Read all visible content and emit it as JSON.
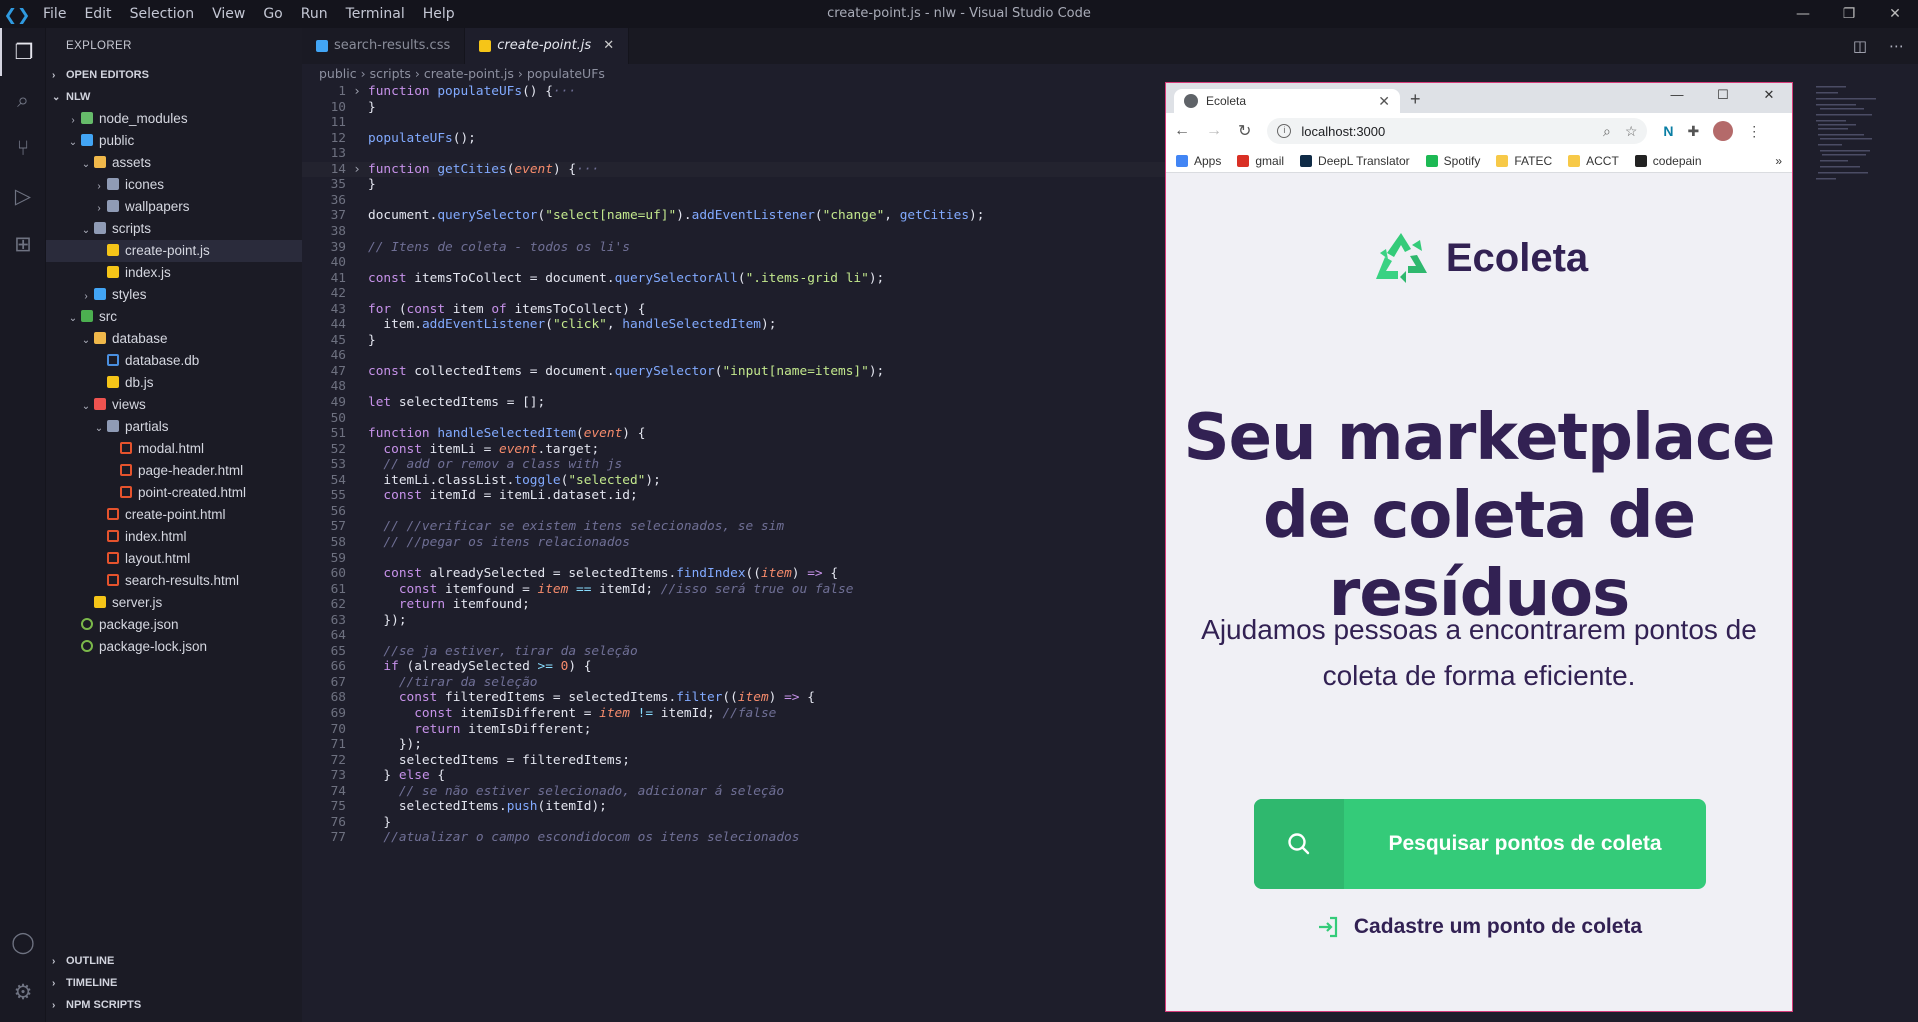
{
  "window": {
    "title": "create-point.js - nlw - Visual Studio Code"
  },
  "menu": [
    "File",
    "Edit",
    "Selection",
    "View",
    "Go",
    "Run",
    "Terminal",
    "Help"
  ],
  "window_controls": {
    "minimize": "—",
    "restore": "❐",
    "close": "✕"
  },
  "sidebar": {
    "title": "EXPLORER",
    "open_editors": "OPEN EDITORS",
    "project": "NLW",
    "tree": [
      {
        "label": "node_modules",
        "type": "folder",
        "kind": "node",
        "depth": 1,
        "arrow": "›"
      },
      {
        "label": "public",
        "type": "folder",
        "kind": "pub",
        "depth": 1,
        "arrow": "⌄"
      },
      {
        "label": "assets",
        "type": "folder",
        "kind": "assets",
        "depth": 2,
        "arrow": "⌄"
      },
      {
        "label": "icones",
        "type": "folder",
        "kind": "plain",
        "depth": 3,
        "arrow": "›"
      },
      {
        "label": "wallpapers",
        "type": "folder",
        "kind": "plain",
        "depth": 3,
        "arrow": "›"
      },
      {
        "label": "scripts",
        "type": "folder",
        "kind": "scripts",
        "depth": 2,
        "arrow": "⌄"
      },
      {
        "label": "create-point.js",
        "type": "js",
        "depth": 3,
        "selected": true
      },
      {
        "label": "index.js",
        "type": "js",
        "depth": 3
      },
      {
        "label": "styles",
        "type": "folder",
        "kind": "styles",
        "depth": 2,
        "arrow": "›"
      },
      {
        "label": "src",
        "type": "folder",
        "kind": "src",
        "depth": 1,
        "arrow": "⌄"
      },
      {
        "label": "database",
        "type": "folder",
        "kind": "db",
        "depth": 2,
        "arrow": "⌄"
      },
      {
        "label": "database.db",
        "type": "db",
        "depth": 3
      },
      {
        "label": "db.js",
        "type": "js",
        "depth": 3
      },
      {
        "label": "views",
        "type": "folder",
        "kind": "views",
        "depth": 2,
        "arrow": "⌄"
      },
      {
        "label": "partials",
        "type": "folder",
        "kind": "plain",
        "depth": 3,
        "arrow": "⌄"
      },
      {
        "label": "modal.html",
        "type": "html",
        "depth": 4
      },
      {
        "label": "page-header.html",
        "type": "html",
        "depth": 4
      },
      {
        "label": "point-created.html",
        "type": "html",
        "depth": 4
      },
      {
        "label": "create-point.html",
        "type": "html",
        "depth": 3
      },
      {
        "label": "index.html",
        "type": "html",
        "depth": 3
      },
      {
        "label": "layout.html",
        "type": "html",
        "depth": 3
      },
      {
        "label": "search-results.html",
        "type": "html",
        "depth": 3
      },
      {
        "label": "server.js",
        "type": "js",
        "depth": 2
      },
      {
        "label": "package.json",
        "type": "json",
        "depth": 1
      },
      {
        "label": "package-lock.json",
        "type": "json",
        "depth": 1
      }
    ],
    "bottom_sections": [
      "OUTLINE",
      "TIMELINE",
      "NPM SCRIPTS"
    ]
  },
  "tabs": [
    {
      "label": "search-results.css",
      "active": false,
      "icon": "css"
    },
    {
      "label": "create-point.js",
      "active": true,
      "icon": "js",
      "close": "✕"
    }
  ],
  "breadcrumb": [
    "public",
    "scripts",
    "create-point.js",
    "populateUFs"
  ],
  "code": [
    {
      "n": "1",
      "fold": "›",
      "t": [
        [
          "k",
          "function "
        ],
        [
          "f",
          "populateUFs"
        ],
        [
          "v",
          "() {"
        ],
        [
          "c",
          "···"
        ]
      ]
    },
    {
      "n": "10",
      "t": [
        [
          "v",
          "}"
        ]
      ]
    },
    {
      "n": "11",
      "t": []
    },
    {
      "n": "12",
      "t": [
        [
          "f",
          "populateUFs"
        ],
        [
          "v",
          "();"
        ]
      ]
    },
    {
      "n": "13",
      "t": []
    },
    {
      "n": "14",
      "fold": "›",
      "cur": true,
      "t": [
        [
          "k",
          "function "
        ],
        [
          "f",
          "getCities"
        ],
        [
          "v",
          "("
        ],
        [
          "p",
          "event"
        ],
        [
          "v",
          ") {"
        ],
        [
          "c",
          "···"
        ]
      ]
    },
    {
      "n": "35",
      "t": [
        [
          "v",
          "}"
        ]
      ]
    },
    {
      "n": "36",
      "t": []
    },
    {
      "n": "37",
      "t": [
        [
          "v",
          "document."
        ],
        [
          "f",
          "querySelector"
        ],
        [
          "v",
          "("
        ],
        [
          "s",
          "\"select[name=uf]\""
        ],
        [
          "v",
          ")."
        ],
        [
          "f",
          "addEventListener"
        ],
        [
          "v",
          "("
        ],
        [
          "s",
          "\"change\""
        ],
        [
          "v",
          ", "
        ],
        [
          "f",
          "getCities"
        ],
        [
          "v",
          ");"
        ]
      ]
    },
    {
      "n": "38",
      "t": []
    },
    {
      "n": "39",
      "t": [
        [
          "c",
          "// Itens de coleta - todos os li's"
        ]
      ]
    },
    {
      "n": "40",
      "t": []
    },
    {
      "n": "41",
      "t": [
        [
          "k",
          "const "
        ],
        [
          "v",
          "itemsToCollect = document."
        ],
        [
          "f",
          "querySelectorAll"
        ],
        [
          "v",
          "("
        ],
        [
          "s",
          "\".items-grid li\""
        ],
        [
          "v",
          ");"
        ]
      ]
    },
    {
      "n": "42",
      "t": []
    },
    {
      "n": "43",
      "t": [
        [
          "k",
          "for "
        ],
        [
          "v",
          "("
        ],
        [
          "k",
          "const "
        ],
        [
          "v",
          "item "
        ],
        [
          "k",
          "of "
        ],
        [
          "v",
          "itemsToCollect) {"
        ]
      ]
    },
    {
      "n": "44",
      "t": [
        [
          "v",
          "  item."
        ],
        [
          "f",
          "addEventListener"
        ],
        [
          "v",
          "("
        ],
        [
          "s",
          "\"click\""
        ],
        [
          "v",
          ", "
        ],
        [
          "f",
          "handleSelectedItem"
        ],
        [
          "v",
          ");"
        ]
      ]
    },
    {
      "n": "45",
      "t": [
        [
          "v",
          "}"
        ]
      ]
    },
    {
      "n": "46",
      "t": []
    },
    {
      "n": "47",
      "t": [
        [
          "k",
          "const "
        ],
        [
          "v",
          "collectedItems = document."
        ],
        [
          "f",
          "querySelector"
        ],
        [
          "v",
          "("
        ],
        [
          "s",
          "\"input[name=items]\""
        ],
        [
          "v",
          ");"
        ]
      ]
    },
    {
      "n": "48",
      "t": []
    },
    {
      "n": "49",
      "t": [
        [
          "k",
          "let "
        ],
        [
          "v",
          "selectedItems = [];"
        ]
      ]
    },
    {
      "n": "50",
      "t": []
    },
    {
      "n": "51",
      "t": [
        [
          "k",
          "function "
        ],
        [
          "f",
          "handleSelectedItem"
        ],
        [
          "v",
          "("
        ],
        [
          "p",
          "event"
        ],
        [
          "v",
          ") {"
        ]
      ]
    },
    {
      "n": "52",
      "t": [
        [
          "k",
          "  const "
        ],
        [
          "v",
          "itemLi = "
        ],
        [
          "p",
          "event"
        ],
        [
          "v",
          ".target;"
        ]
      ]
    },
    {
      "n": "53",
      "t": [
        [
          "c",
          "  // add or remov a class with js"
        ]
      ]
    },
    {
      "n": "54",
      "t": [
        [
          "v",
          "  itemLi.classList."
        ],
        [
          "f",
          "toggle"
        ],
        [
          "v",
          "("
        ],
        [
          "s",
          "\"selected\""
        ],
        [
          "v",
          ");"
        ]
      ]
    },
    {
      "n": "55",
      "t": [
        [
          "k",
          "  const "
        ],
        [
          "v",
          "itemId = itemLi.dataset.id;"
        ]
      ]
    },
    {
      "n": "56",
      "t": []
    },
    {
      "n": "57",
      "t": [
        [
          "c",
          "  // //verificar se existem itens selecionados, se sim"
        ]
      ]
    },
    {
      "n": "58",
      "t": [
        [
          "c",
          "  // //pegar os itens relacionados"
        ]
      ]
    },
    {
      "n": "59",
      "t": []
    },
    {
      "n": "60",
      "t": [
        [
          "k",
          "  const "
        ],
        [
          "v",
          "alreadySelected = selectedItems."
        ],
        [
          "f",
          "findIndex"
        ],
        [
          "v",
          "(("
        ],
        [
          "p",
          "item"
        ],
        [
          "v",
          ") "
        ],
        [
          "k",
          "=>"
        ],
        [
          "v",
          " {"
        ]
      ]
    },
    {
      "n": "61",
      "t": [
        [
          "k",
          "    const "
        ],
        [
          "v",
          "itemfound = "
        ],
        [
          "p",
          "item"
        ],
        [
          "o",
          " == "
        ],
        [
          "v",
          "itemId; "
        ],
        [
          "c",
          "//isso será true ou false"
        ]
      ]
    },
    {
      "n": "62",
      "t": [
        [
          "k",
          "    return "
        ],
        [
          "v",
          "itemfound;"
        ]
      ]
    },
    {
      "n": "63",
      "t": [
        [
          "v",
          "  });"
        ]
      ]
    },
    {
      "n": "64",
      "t": []
    },
    {
      "n": "65",
      "t": [
        [
          "c",
          "  //se ja estiver, tirar da seleção"
        ]
      ]
    },
    {
      "n": "66",
      "t": [
        [
          "k",
          "  if "
        ],
        [
          "v",
          "(alreadySelected "
        ],
        [
          "o",
          ">="
        ],
        [
          "n",
          " 0"
        ],
        [
          "v",
          ") {"
        ]
      ]
    },
    {
      "n": "67",
      "t": [
        [
          "c",
          "    //tirar da seleção"
        ]
      ]
    },
    {
      "n": "68",
      "t": [
        [
          "k",
          "    const "
        ],
        [
          "v",
          "filteredItems = selectedItems."
        ],
        [
          "f",
          "filter"
        ],
        [
          "v",
          "(("
        ],
        [
          "p",
          "item"
        ],
        [
          "v",
          ") "
        ],
        [
          "k",
          "=>"
        ],
        [
          "v",
          " {"
        ]
      ]
    },
    {
      "n": "69",
      "t": [
        [
          "k",
          "      const "
        ],
        [
          "v",
          "itemIsDifferent = "
        ],
        [
          "p",
          "item"
        ],
        [
          "o",
          " != "
        ],
        [
          "v",
          "itemId; "
        ],
        [
          "c",
          "//false"
        ]
      ]
    },
    {
      "n": "70",
      "t": [
        [
          "k",
          "      return "
        ],
        [
          "v",
          "itemIsDifferent;"
        ]
      ]
    },
    {
      "n": "71",
      "t": [
        [
          "v",
          "    });"
        ]
      ]
    },
    {
      "n": "72",
      "t": [
        [
          "v",
          "    selectedItems = filteredItems;"
        ]
      ]
    },
    {
      "n": "73",
      "t": [
        [
          "v",
          "  } "
        ],
        [
          "k",
          "else "
        ],
        [
          "v",
          "{"
        ]
      ]
    },
    {
      "n": "74",
      "t": [
        [
          "c",
          "    // se não estiver selecionado, adicionar á seleção"
        ]
      ]
    },
    {
      "n": "75",
      "t": [
        [
          "v",
          "    selectedItems."
        ],
        [
          "f",
          "push"
        ],
        [
          "v",
          "(itemId);"
        ]
      ]
    },
    {
      "n": "76",
      "t": [
        [
          "v",
          "  }"
        ]
      ]
    },
    {
      "n": "77",
      "t": [
        [
          "c",
          "  //atualizar o campo escondidocom os itens selecionados"
        ]
      ]
    }
  ],
  "browser": {
    "tab_title": "Ecoleta",
    "tab_close": "✕",
    "new_tab": "+",
    "url": "localhost:3000",
    "bookmarks": [
      {
        "label": "Apps",
        "color": "#4285f4"
      },
      {
        "label": "gmail",
        "color": "#d93025"
      },
      {
        "label": "DeepL Translator",
        "color": "#0f2b46"
      },
      {
        "label": "Spotify",
        "color": "#1db954"
      },
      {
        "label": "FATEC",
        "color": "#f7c948"
      },
      {
        "label": "ACCT",
        "color": "#f7c948"
      },
      {
        "label": "codepain",
        "color": "#222222"
      }
    ],
    "bookmarks_more": "»",
    "controls": {
      "minimize": "—",
      "maximize": "☐",
      "close": "✕"
    }
  },
  "page": {
    "logo_text": "Ecoleta",
    "headline": "Seu marketplace de coleta de resíduos",
    "subline": "Ajudamos pessoas a encontrarem pontos de coleta de forma eficiente.",
    "search_button": "Pesquisar pontos de coleta",
    "register_link": "Cadastre um ponto de coleta",
    "colors": {
      "primary": "#322153",
      "green": "#34cb79"
    }
  }
}
